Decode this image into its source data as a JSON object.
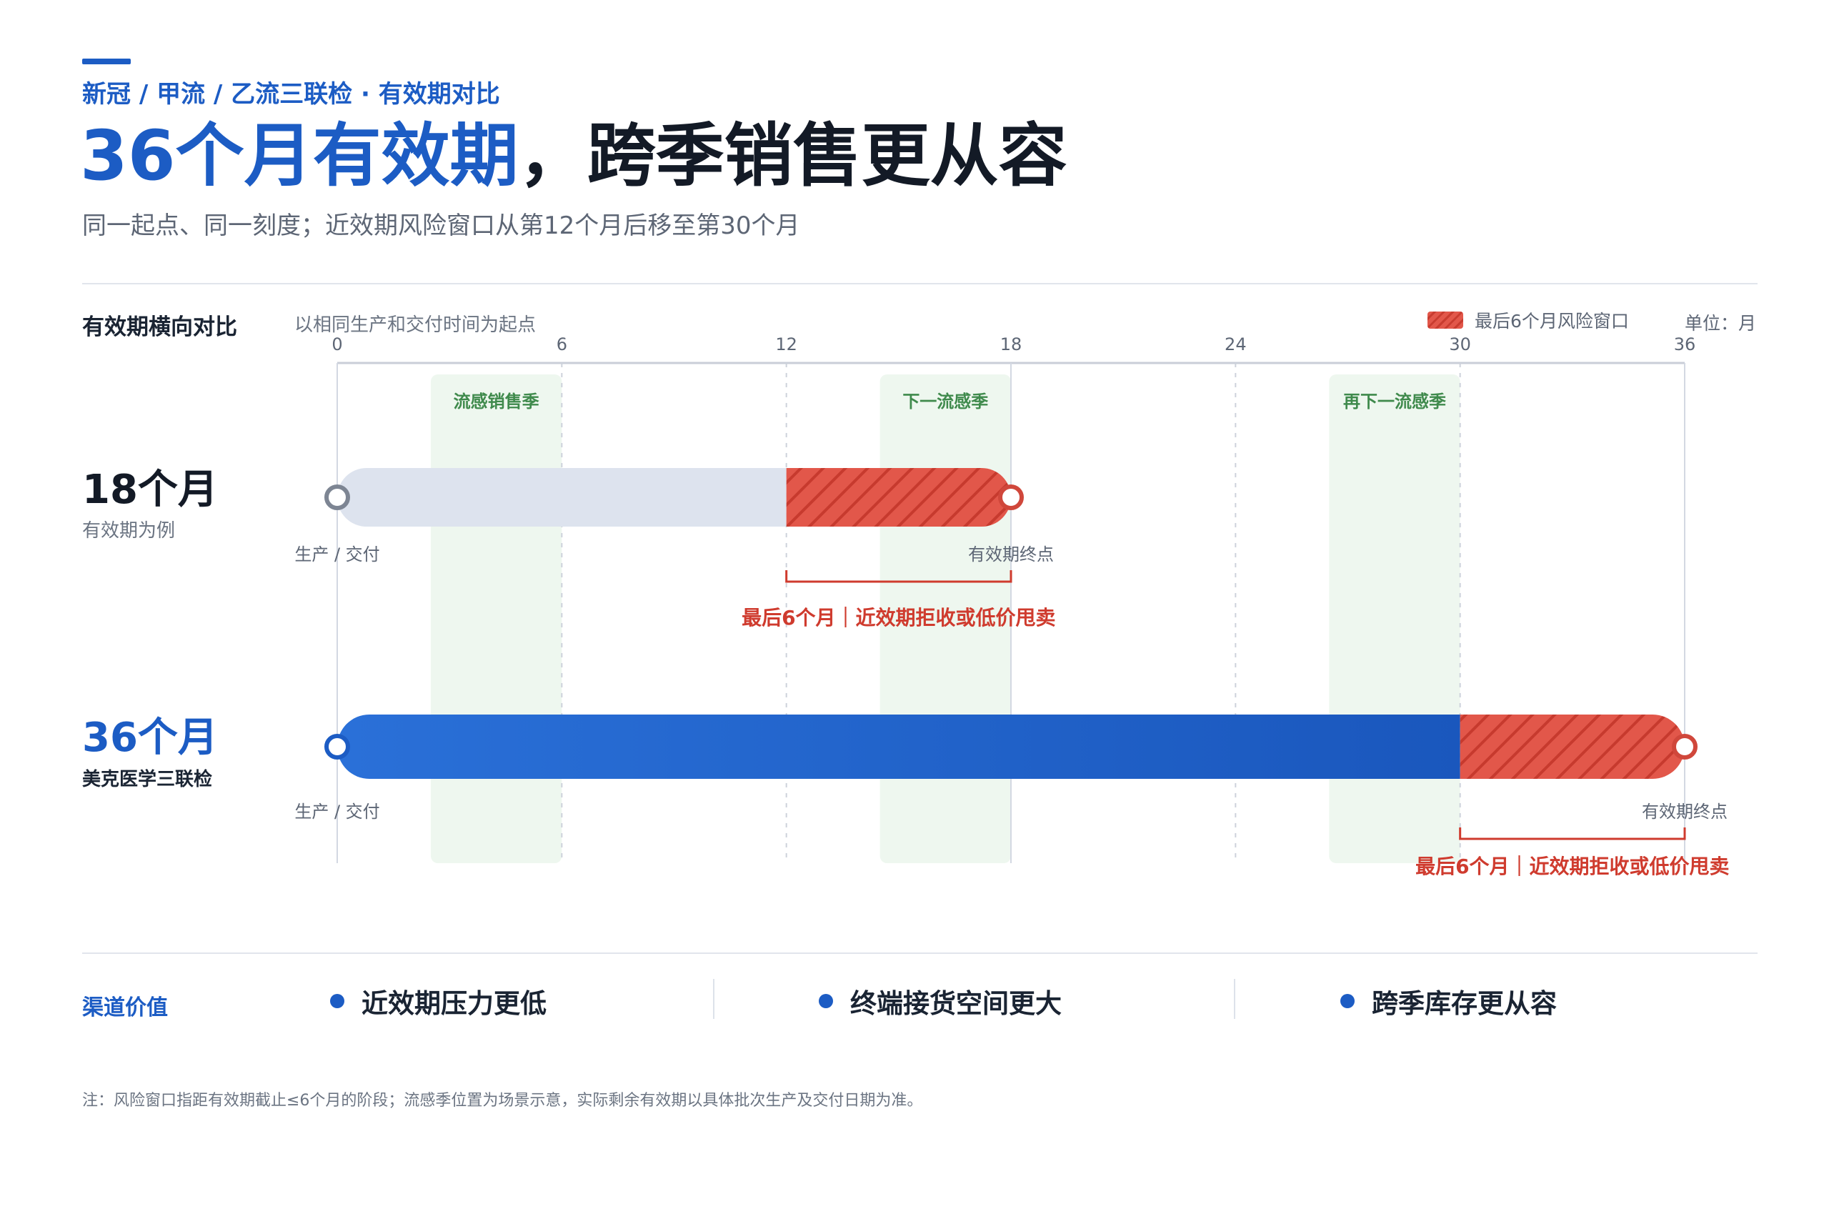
{
  "header": {
    "eyebrow": "新冠 / 甲流 / 乙流三联检 · 有效期对比",
    "title_highlight": "36个月有效期",
    "title_rest": "，跨季销售更从容",
    "subtitle": "同一起点、同一刻度；近效期风险窗口从第12个月后移至第30个月"
  },
  "colors": {
    "accent": "#1c5cc4",
    "risk": "#e2574a",
    "risk_text": "#cf3b2e",
    "season_bg": "#eef7ef",
    "season_text": "#3f8a4c",
    "bar_18": "#dde3ee",
    "dark": "#1a2433"
  },
  "chart_data": {
    "type": "bar",
    "orientation": "horizontal",
    "section_label": "有效期横向对比",
    "note": "以相同生产和交付时间为起点",
    "unit_label": "单位：月",
    "legend": [
      {
        "name": "最后6个月风险窗口",
        "color": "#e2574a"
      }
    ],
    "x_range": [
      0,
      36
    ],
    "x_ticks": [
      0,
      6,
      12,
      18,
      24,
      30,
      36
    ],
    "grid": true,
    "seasons": [
      {
        "label": "流感销售季",
        "start": 2.5,
        "end": 6
      },
      {
        "label": "下一流感季",
        "start": 14.5,
        "end": 18
      },
      {
        "label": "再下一流感季",
        "start": 26.5,
        "end": 30
      }
    ],
    "series": [
      {
        "name": "18个月",
        "subtitle": "有效期为例",
        "start": 0,
        "end": 18,
        "risk_start": 12,
        "color": "#dde3ee",
        "start_label": "生产 / 交付",
        "end_label": "有效期终点",
        "risk_label": "最后6个月｜近效期拒收或低价甩卖"
      },
      {
        "name": "36个月",
        "subtitle": "美克医学三联检",
        "start": 0,
        "end": 36,
        "risk_start": 30,
        "color": "#1c5cc4",
        "start_label": "生产 / 交付",
        "end_label": "有效期终点",
        "risk_label": "最后6个月｜近效期拒收或低价甩卖"
      }
    ]
  },
  "footer": {
    "label": "渠道价值",
    "values": [
      "近效期压力更低",
      "终端接货空间更大",
      "跨季库存更从容"
    ],
    "note": "注：风险窗口指距有效期截止≤6个月的阶段；流感季位置为场景示意，实际剩余有效期以具体批次生产及交付日期为准。"
  }
}
